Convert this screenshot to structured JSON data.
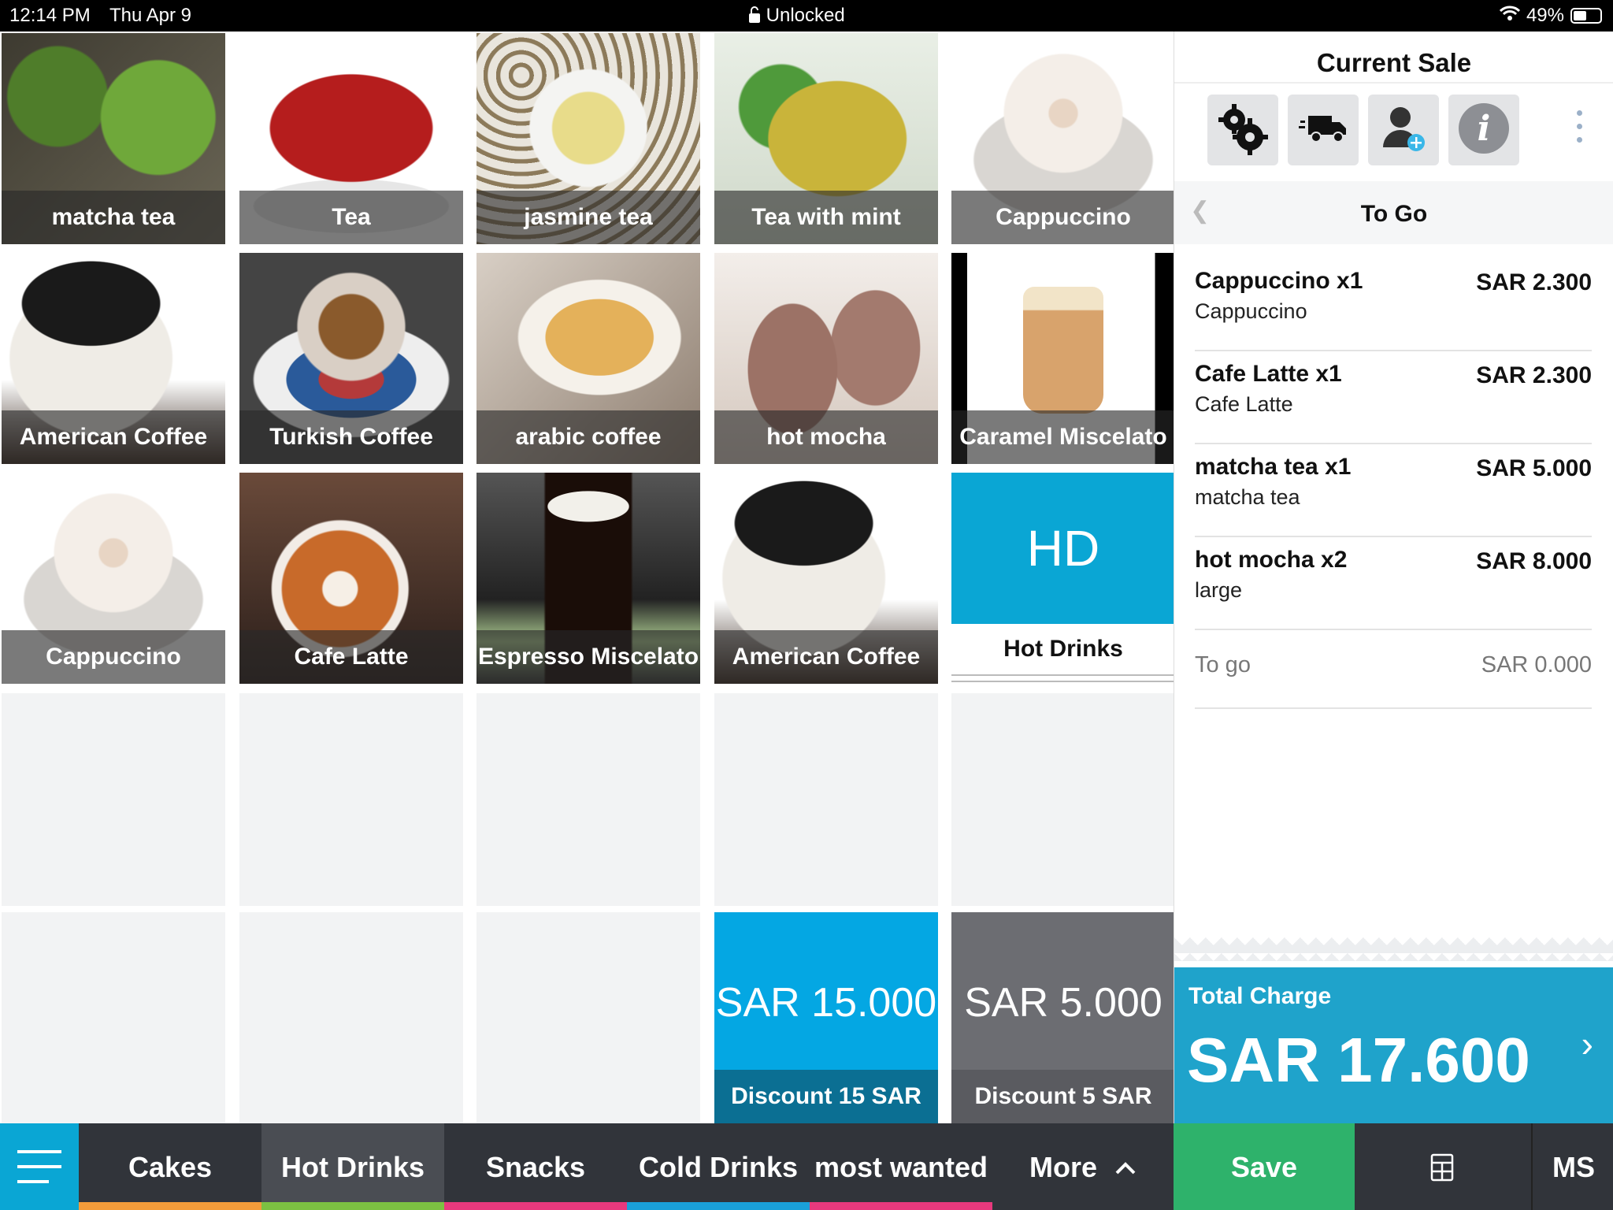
{
  "status_bar": {
    "time": "12:14 PM",
    "date": "Thu Apr 9",
    "lock_text": "Unlocked",
    "battery": "49%",
    "battery_level": 0.49,
    "icons": [
      "lock-icon",
      "wifi-icon",
      "battery-icon"
    ]
  },
  "products": [
    {
      "label": "matcha tea",
      "image": "matcha"
    },
    {
      "label": "Tea",
      "image": "tea"
    },
    {
      "label": "jasmine tea",
      "image": "jasmine"
    },
    {
      "label": "Tea with mint",
      "image": "mint"
    },
    {
      "label": "Cappuccino",
      "image": "cappu"
    },
    {
      "label": "American Coffee",
      "image": "american"
    },
    {
      "label": "Turkish Coffee",
      "image": "turkish"
    },
    {
      "label": "arabic coffee",
      "image": "arabic"
    },
    {
      "label": "hot mocha",
      "image": "mocha"
    },
    {
      "label": "Caramel Miscelato",
      "image": "caramel"
    },
    {
      "label": "Cappuccino",
      "image": "cappu"
    },
    {
      "label": "Cafe Latte",
      "image": "latte"
    },
    {
      "label": "Espresso Miscelato",
      "image": "espresso"
    },
    {
      "label": "American Coffee",
      "image": "american"
    }
  ],
  "category_tile": {
    "abbr": "HD",
    "label": "Hot Drinks",
    "color": "#0aa6d4"
  },
  "discounts": [
    {
      "amount": "SAR 15.000",
      "label": "Discount 15 SAR",
      "color": "#04a7e3",
      "label_color": "#0b6f93"
    },
    {
      "amount": "SAR 5.000",
      "label": "Discount 5 SAR",
      "color": "#6c6d72",
      "label_color": "#5a5b60"
    }
  ],
  "sale": {
    "title": "Current Sale",
    "actions": [
      "settings-gears-icon",
      "delivery-truck-icon",
      "add-customer-icon",
      "info-icon"
    ],
    "order_type": "To Go",
    "items": [
      {
        "name": "Cappuccino x1",
        "sub": "Cappuccino",
        "price": "SAR 2.300"
      },
      {
        "name": "Cafe Latte x1",
        "sub": "Cafe Latte",
        "price": "SAR 2.300"
      },
      {
        "name": "matcha tea x1",
        "sub": "matcha tea",
        "price": "SAR 5.000"
      },
      {
        "name": "hot mocha x2",
        "sub": "large",
        "price": "SAR 8.000"
      }
    ],
    "fee": {
      "name": "To go",
      "price": "SAR 0.000"
    },
    "total_label": "Total Charge",
    "total_value": "SAR 17.600"
  },
  "bottom_tabs": [
    {
      "label": "Cakes",
      "color": "#f39c3a"
    },
    {
      "label": "Hot Drinks",
      "color": "#7cc142",
      "active": true
    },
    {
      "label": "Snacks",
      "color": "#e8397d"
    },
    {
      "label": "Cold Drinks",
      "color": "#1aa0d8"
    },
    {
      "label": "most wanted",
      "color": "#e8397d"
    },
    {
      "label": "More",
      "color": ""
    }
  ],
  "footer": {
    "save_label": "Save",
    "ms_label": "MS"
  }
}
